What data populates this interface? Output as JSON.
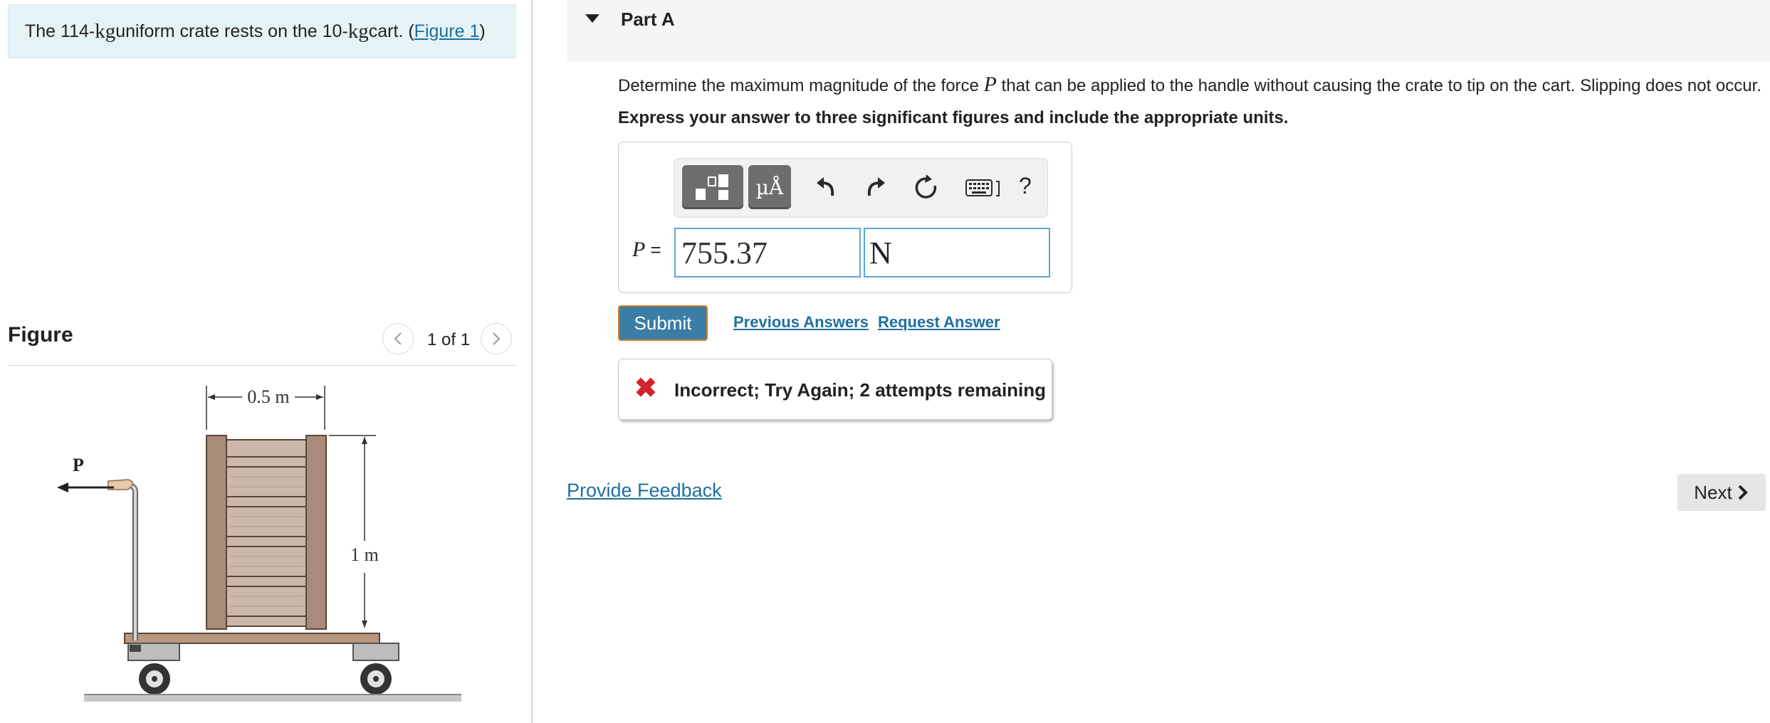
{
  "problem": {
    "text_before_mass1": "The 114-",
    "unit_mass": "kg",
    "text_between": " uniform crate rests on the 10-",
    "text_after": " cart. (",
    "figure_link": "Figure 1",
    "close_paren": ")"
  },
  "figure": {
    "title": "Figure",
    "pager": "1 of 1",
    "label_width": "0.5 m",
    "label_height": "1 m",
    "label_force": "P"
  },
  "part": {
    "title": "Part A",
    "question_before": "Determine the maximum magnitude of the force ",
    "question_var": "P",
    "question_after": " that can be applied to the handle without causing the crate to tip on the cart. Slipping does not occur.",
    "instruction": "Express your answer to three significant figures and include the appropriate units."
  },
  "toolbar": {
    "units_label": "µÅ",
    "help_label": "?"
  },
  "answer": {
    "var_label": "P",
    "equals": " =",
    "value": "755.37",
    "unit": "N"
  },
  "actions": {
    "submit": "Submit",
    "previous_answers": "Previous Answers",
    "request_answer": "Request Answer"
  },
  "feedback": {
    "icon": "✖",
    "message": "Incorrect; Try Again; 2 attempts remaining"
  },
  "footer": {
    "provide_feedback": "Provide Feedback",
    "next": "Next"
  },
  "colors": {
    "link": "#1f6f9f",
    "submit_bg": "#3a7ea5",
    "error": "#d3232b",
    "problem_bg": "#e6f3f6"
  }
}
